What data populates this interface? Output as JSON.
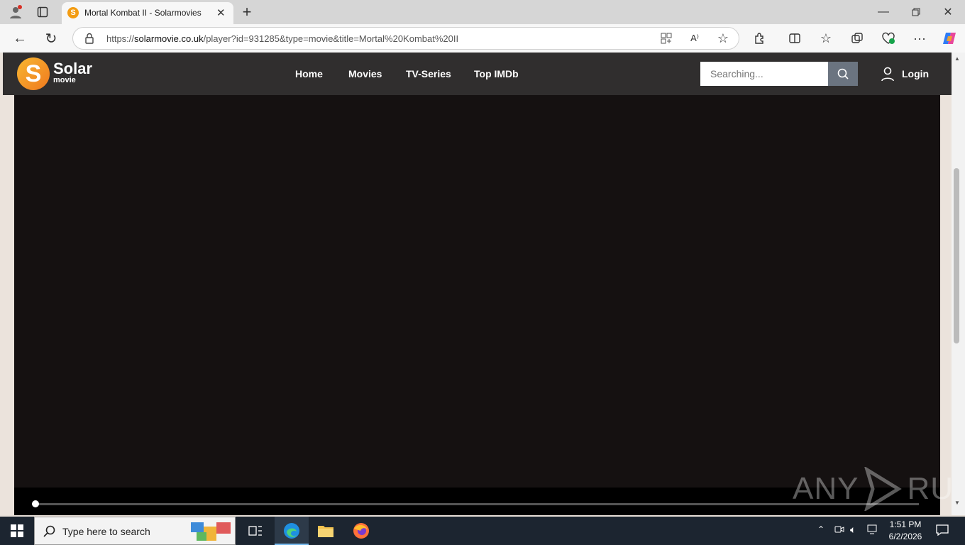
{
  "browser": {
    "tab": {
      "title": "Mortal Kombat II - Solarmovies",
      "favicon": "S"
    },
    "url_prefix": "https://",
    "url_domain": "solarmovie.co.uk",
    "url_path": "/player?id=931285&type=movie&title=Mortal%20Kombat%20II"
  },
  "site": {
    "logo_letter": "S",
    "logo_name": "Solar",
    "logo_sub": "movie",
    "nav": [
      "Home",
      "Movies",
      "TV-Series",
      "Top IMDb"
    ],
    "search_placeholder": "Searching...",
    "login_label": "Login"
  },
  "player": {
    "progress_fraction": 0.0
  },
  "watermark": {
    "left": "ANY",
    "right": "RUN"
  },
  "taskbar": {
    "search_placeholder": "Type here to search",
    "time": "1:51 PM",
    "date": "6/2/2026"
  },
  "colors": {
    "header_bg": "#302e2e",
    "player_bg": "#151111",
    "brand_orange": "#f39c12",
    "taskbar_bg": "#1c2530"
  }
}
